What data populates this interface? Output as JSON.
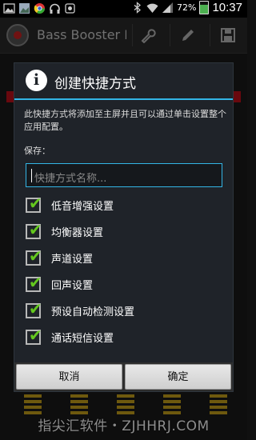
{
  "status_bar": {
    "battery": "72%",
    "time": "10:37",
    "battery_fill_fraction": 0.72,
    "icons": [
      "image-icon",
      "gallery-icon",
      "chrome-icon",
      "headphones-icon",
      "notification-icon",
      "bluetooth-icon",
      "wifi-icon",
      "signal-icon",
      "battery-icon"
    ]
  },
  "app_bar": {
    "title": "Bass Booster P",
    "actions": [
      "wrench-icon",
      "pencil-icon",
      "save-icon"
    ]
  },
  "dialog": {
    "title": "创建快捷方式",
    "description": "此快捷方式将添加至主屏并且可以通过单击设置整个应用配置。",
    "save_label": "保存：",
    "name_input": {
      "value": "",
      "placeholder": "快捷方式名称..."
    },
    "options": [
      {
        "label": "低音增强设置",
        "checked": true
      },
      {
        "label": "均衡器设置",
        "checked": true
      },
      {
        "label": "声道设置",
        "checked": true
      },
      {
        "label": "回声设置",
        "checked": true
      },
      {
        "label": "预设自动检测设置",
        "checked": true
      },
      {
        "label": "通话短信设置",
        "checked": true
      }
    ],
    "cancel_label": "取消",
    "ok_label": "确定"
  },
  "watermark": "指尖汇软件・ZJHHRJ.COM",
  "colors": {
    "accent": "#33b5e5",
    "check": "#64c81e",
    "eq": "#c9a21a",
    "bar": "#c0101a"
  }
}
